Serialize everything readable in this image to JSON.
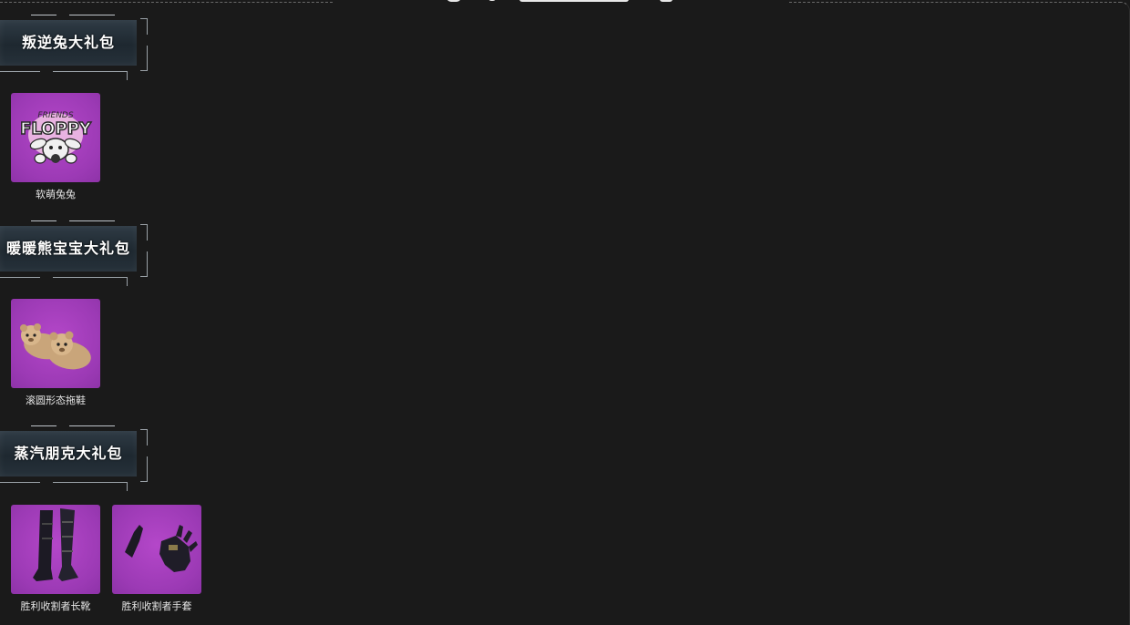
{
  "panel": {
    "background": "#1a1a1a",
    "tile_color": "#a03cb8"
  },
  "sections": [
    {
      "title": "叛逆兔大礼包",
      "items": [
        {
          "name": "软萌兔兔",
          "icon": "floppy-bunny-icon"
        }
      ]
    },
    {
      "title": "暖暖熊宝宝大礼包",
      "items": [
        {
          "name": "滚圆形态拖鞋",
          "icon": "bear-slippers-icon"
        }
      ]
    },
    {
      "title": "蒸汽朋克大礼包",
      "items": [
        {
          "name": "胜利收割者长靴",
          "icon": "boots-icon"
        },
        {
          "name": "胜利收割者手套",
          "icon": "gloves-icon"
        }
      ]
    }
  ]
}
